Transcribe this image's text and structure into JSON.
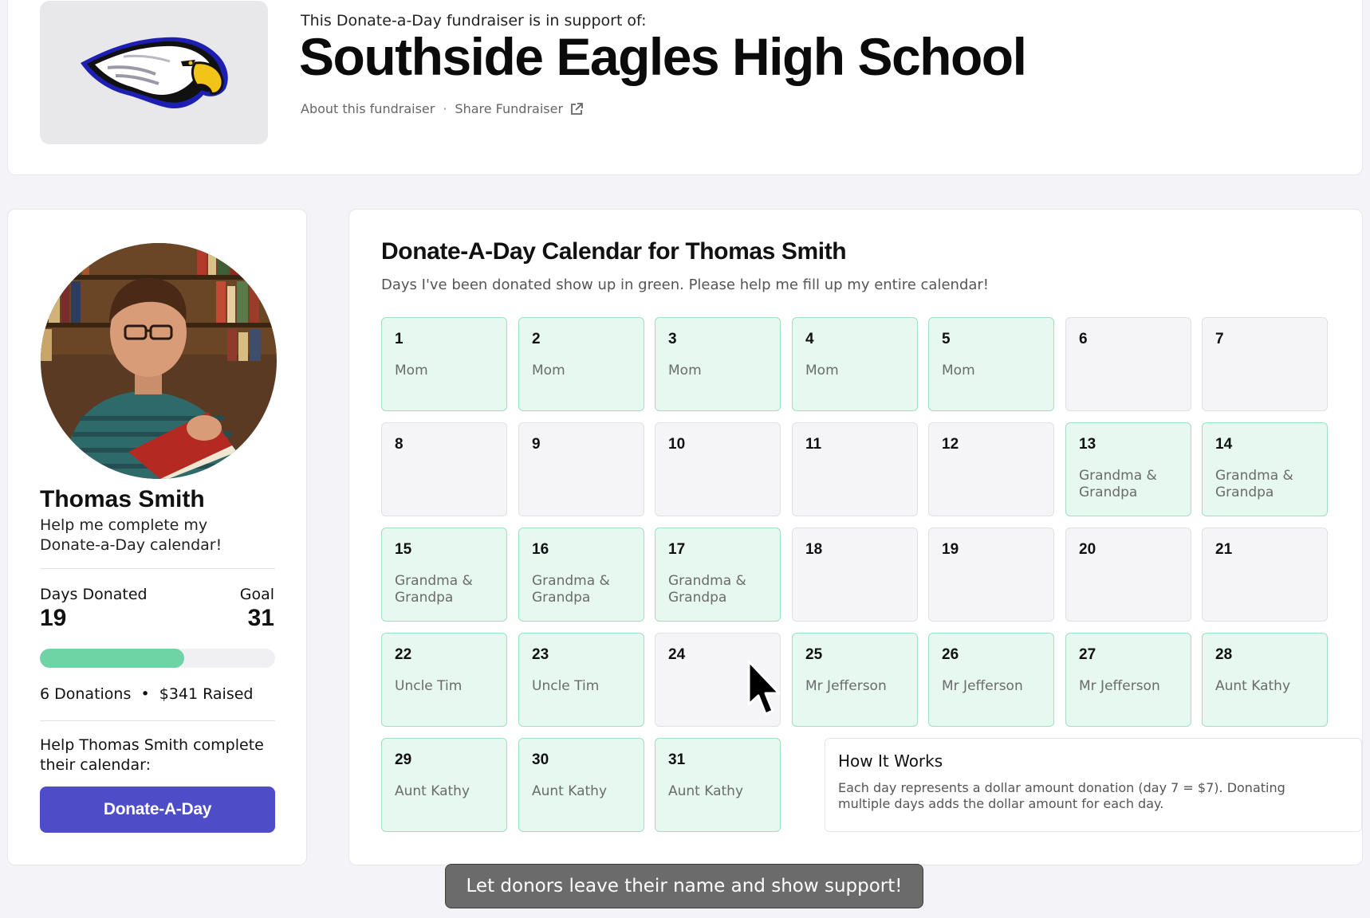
{
  "header": {
    "support_text": "This Donate-a-Day fundraiser is in support of:",
    "school_name": "Southside Eagles High School",
    "about_link": "About this fundraiser",
    "separator": "·",
    "share_link": "Share Fundraiser",
    "logo_icon": "eagle-logo"
  },
  "profile": {
    "name": "Thomas Smith",
    "tagline": "Help me complete my Donate-a-Day calendar!",
    "days_label": "Days Donated",
    "goal_label": "Goal",
    "days_value": "19",
    "goal_value": "31",
    "progress_fraction": 0.613,
    "donation_stats": "6 Donations  •  $341 Raised",
    "help_text": "Help Thomas Smith complete their calendar:",
    "donate_button": "Donate-A-Day",
    "accent_color": "#4f4cc8",
    "progress_color": "#6fd4a5"
  },
  "calendar": {
    "title": "Donate-A-Day Calendar for Thomas Smith",
    "subtitle": "Days I've been donated show up in green. Please help me fill up my entire calendar!",
    "filled_color": "#e6f8f0",
    "days": [
      {
        "num": "1",
        "donor": "Mom"
      },
      {
        "num": "2",
        "donor": "Mom"
      },
      {
        "num": "3",
        "donor": "Mom"
      },
      {
        "num": "4",
        "donor": "Mom"
      },
      {
        "num": "5",
        "donor": "Mom"
      },
      {
        "num": "6",
        "donor": ""
      },
      {
        "num": "7",
        "donor": ""
      },
      {
        "num": "8",
        "donor": ""
      },
      {
        "num": "9",
        "donor": ""
      },
      {
        "num": "10",
        "donor": ""
      },
      {
        "num": "11",
        "donor": ""
      },
      {
        "num": "12",
        "donor": ""
      },
      {
        "num": "13",
        "donor": "Grandma & Grandpa"
      },
      {
        "num": "14",
        "donor": "Grandma & Grandpa"
      },
      {
        "num": "15",
        "donor": "Grandma & Grandpa"
      },
      {
        "num": "16",
        "donor": "Grandma & Grandpa"
      },
      {
        "num": "17",
        "donor": "Grandma & Grandpa"
      },
      {
        "num": "18",
        "donor": ""
      },
      {
        "num": "19",
        "donor": ""
      },
      {
        "num": "20",
        "donor": ""
      },
      {
        "num": "21",
        "donor": ""
      },
      {
        "num": "22",
        "donor": "Uncle Tim"
      },
      {
        "num": "23",
        "donor": "Uncle Tim"
      },
      {
        "num": "24",
        "donor": ""
      },
      {
        "num": "25",
        "donor": "Mr Jefferson"
      },
      {
        "num": "26",
        "donor": "Mr Jefferson"
      },
      {
        "num": "27",
        "donor": "Mr Jefferson"
      },
      {
        "num": "28",
        "donor": "Aunt Kathy"
      },
      {
        "num": "29",
        "donor": "Aunt Kathy"
      },
      {
        "num": "30",
        "donor": "Aunt Kathy"
      },
      {
        "num": "31",
        "donor": "Aunt Kathy"
      }
    ],
    "how_title": "How It Works",
    "how_body": "Each day represents a dollar amount donation (day 7 = $7). Donating multiple days adds the dollar amount for each day."
  },
  "caption": "Let donors leave their name and show support!"
}
